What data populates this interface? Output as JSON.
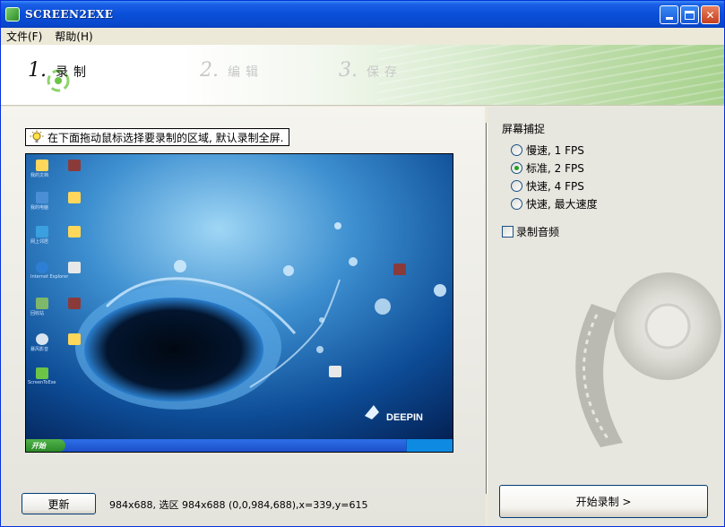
{
  "window": {
    "title": "SCREEN2EXE",
    "buttons": {
      "minimize": "minimize-icon",
      "maximize": "maximize-icon",
      "close_label": "✕"
    }
  },
  "menu": [
    {
      "label": "文件(F)"
    },
    {
      "label": "帮助(H)"
    }
  ],
  "steps": [
    {
      "num": "1.",
      "label": "录制",
      "active": true
    },
    {
      "num": "2.",
      "label": "编辑",
      "active": false
    },
    {
      "num": "3.",
      "label": "保存",
      "active": false
    }
  ],
  "hint": {
    "text": "在下面拖动鼠标选择要录制的区域, 默认录制全屏.",
    "icon": "lightbulb-icon"
  },
  "preview": {
    "desktop_icons": [
      {
        "label": "我的文档"
      },
      {
        "label": "我的电脑"
      },
      {
        "label": "网上邻居"
      },
      {
        "label": "Internet Explorer"
      },
      {
        "label": "回收站"
      },
      {
        "label": "暴风影音"
      },
      {
        "label": "ScreenToExe"
      }
    ],
    "start_label": "开始",
    "brand": "DEEPIN"
  },
  "update_button": "更新",
  "status": "984x688, 选区 984x688 (0,0,984,688),x=339,y=615",
  "capture": {
    "title": "屏幕捕捉",
    "options": [
      {
        "label": "慢速, 1 FPS",
        "selected": false
      },
      {
        "label": "标准, 2 FPS",
        "selected": true
      },
      {
        "label": "快速, 4 FPS",
        "selected": false
      },
      {
        "label": "快速, 最大速度",
        "selected": false
      }
    ],
    "audio_label": "录制音频",
    "audio_checked": false
  },
  "start_button": "开始录制 >"
}
